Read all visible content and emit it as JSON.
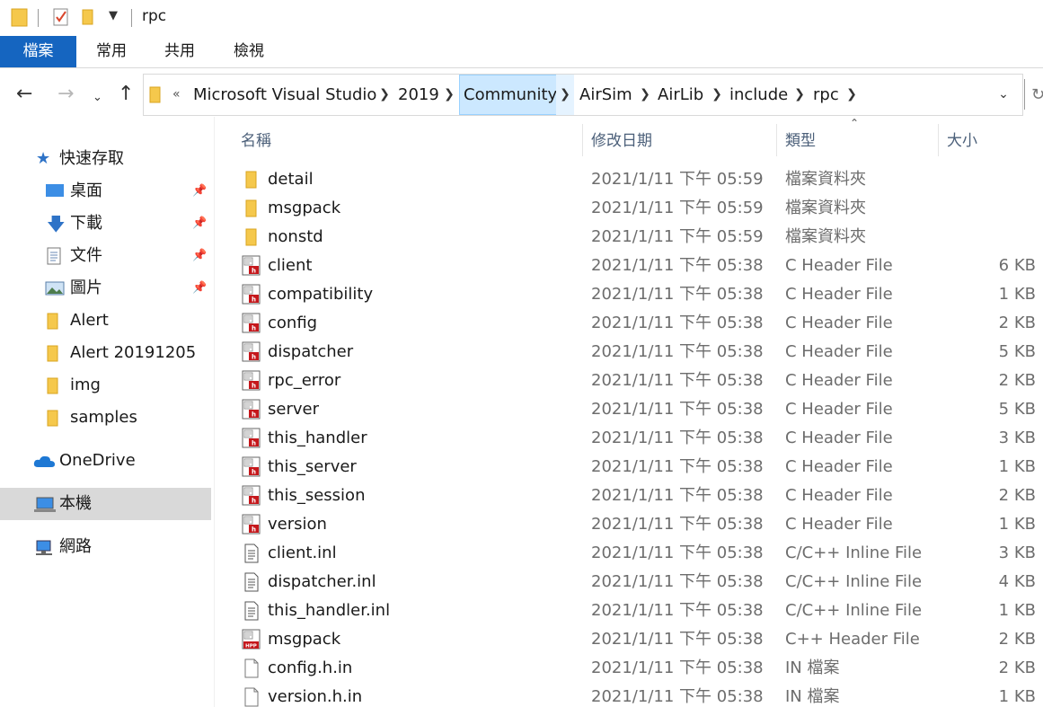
{
  "window": {
    "title": "rpc"
  },
  "ribbon": {
    "tabs": [
      {
        "label": "檔案",
        "active": true
      },
      {
        "label": "常用",
        "active": false
      },
      {
        "label": "共用",
        "active": false
      },
      {
        "label": "檢視",
        "active": false
      }
    ]
  },
  "address": {
    "overflow": "«",
    "crumbs": [
      "Microsoft Visual Studio",
      "2019",
      "Community",
      "AirSim",
      "AirLib",
      "include",
      "rpc"
    ],
    "highlighted": "Community"
  },
  "sidebar": {
    "quick_access": "快速存取",
    "items": [
      {
        "label": "桌面",
        "icon": "desktop-icon",
        "pinned": true
      },
      {
        "label": "下載",
        "icon": "download-icon",
        "pinned": true
      },
      {
        "label": "文件",
        "icon": "document-icon",
        "pinned": true
      },
      {
        "label": "圖片",
        "icon": "picture-icon",
        "pinned": true
      },
      {
        "label": "Alert",
        "icon": "folder-icon",
        "pinned": false
      },
      {
        "label": "Alert 20191205",
        "icon": "folder-icon",
        "pinned": false
      },
      {
        "label": "img",
        "icon": "folder-icon",
        "pinned": false
      },
      {
        "label": "samples",
        "icon": "folder-icon",
        "pinned": false
      }
    ],
    "onedrive": "OneDrive",
    "this_pc": "本機",
    "network": "網路"
  },
  "columns": {
    "name": "名稱",
    "date": "修改日期",
    "type": "類型",
    "size": "大小"
  },
  "files": [
    {
      "name": "detail",
      "date": "2021/1/11 下午 05:59",
      "type": "檔案資料夾",
      "size": "",
      "icon": "folder-icon"
    },
    {
      "name": "msgpack",
      "date": "2021/1/11 下午 05:59",
      "type": "檔案資料夾",
      "size": "",
      "icon": "folder-icon"
    },
    {
      "name": "nonstd",
      "date": "2021/1/11 下午 05:59",
      "type": "檔案資料夾",
      "size": "",
      "icon": "folder-icon"
    },
    {
      "name": "client",
      "date": "2021/1/11 下午 05:38",
      "type": "C Header File",
      "size": "6 KB",
      "icon": "h-file-icon"
    },
    {
      "name": "compatibility",
      "date": "2021/1/11 下午 05:38",
      "type": "C Header File",
      "size": "1 KB",
      "icon": "h-file-icon"
    },
    {
      "name": "config",
      "date": "2021/1/11 下午 05:38",
      "type": "C Header File",
      "size": "2 KB",
      "icon": "h-file-icon"
    },
    {
      "name": "dispatcher",
      "date": "2021/1/11 下午 05:38",
      "type": "C Header File",
      "size": "5 KB",
      "icon": "h-file-icon"
    },
    {
      "name": "rpc_error",
      "date": "2021/1/11 下午 05:38",
      "type": "C Header File",
      "size": "2 KB",
      "icon": "h-file-icon"
    },
    {
      "name": "server",
      "date": "2021/1/11 下午 05:38",
      "type": "C Header File",
      "size": "5 KB",
      "icon": "h-file-icon"
    },
    {
      "name": "this_handler",
      "date": "2021/1/11 下午 05:38",
      "type": "C Header File",
      "size": "3 KB",
      "icon": "h-file-icon"
    },
    {
      "name": "this_server",
      "date": "2021/1/11 下午 05:38",
      "type": "C Header File",
      "size": "1 KB",
      "icon": "h-file-icon"
    },
    {
      "name": "this_session",
      "date": "2021/1/11 下午 05:38",
      "type": "C Header File",
      "size": "2 KB",
      "icon": "h-file-icon"
    },
    {
      "name": "version",
      "date": "2021/1/11 下午 05:38",
      "type": "C Header File",
      "size": "1 KB",
      "icon": "h-file-icon"
    },
    {
      "name": "client.inl",
      "date": "2021/1/11 下午 05:38",
      "type": "C/C++ Inline File",
      "size": "3 KB",
      "icon": "text-file-icon"
    },
    {
      "name": "dispatcher.inl",
      "date": "2021/1/11 下午 05:38",
      "type": "C/C++ Inline File",
      "size": "4 KB",
      "icon": "text-file-icon"
    },
    {
      "name": "this_handler.inl",
      "date": "2021/1/11 下午 05:38",
      "type": "C/C++ Inline File",
      "size": "1 KB",
      "icon": "text-file-icon"
    },
    {
      "name": "msgpack",
      "date": "2021/1/11 下午 05:38",
      "type": "C++ Header File",
      "size": "2 KB",
      "icon": "hpp-file-icon"
    },
    {
      "name": "config.h.in",
      "date": "2021/1/11 下午 05:38",
      "type": "IN 檔案",
      "size": "2 KB",
      "icon": "blank-file-icon"
    },
    {
      "name": "version.h.in",
      "date": "2021/1/11 下午 05:38",
      "type": "IN 檔案",
      "size": "1 KB",
      "icon": "blank-file-icon"
    }
  ]
}
